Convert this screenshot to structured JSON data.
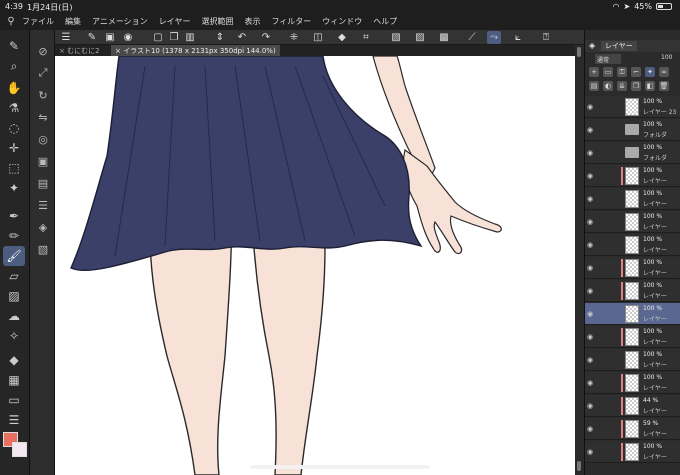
{
  "status": {
    "time": "4:39",
    "date": "1月24日(日)",
    "battery": "45%",
    "battery_level": 0.45
  },
  "menu": [
    "ファイル",
    "編集",
    "アニメーション",
    "レイヤー",
    "選択範囲",
    "表示",
    "フィルター",
    "ウィンドウ",
    "ヘルプ"
  ],
  "tabs": {
    "tab1": "むにむに2",
    "tab2": "イラスト10 (1378 x 2131px 350dpi 144.0%)"
  },
  "layer_panel": {
    "title": "レイヤー",
    "blend_mode": "通常",
    "opacity": "100",
    "layers": [
      {
        "pct": "100 %",
        "name": "レイヤー 23",
        "kind": "layer",
        "mask": false
      },
      {
        "pct": "100 %",
        "name": "フォルダ",
        "kind": "folder",
        "mask": false
      },
      {
        "pct": "100 %",
        "name": "フォルダ",
        "kind": "folder",
        "mask": false
      },
      {
        "pct": "100 %",
        "name": "レイヤー",
        "kind": "layer",
        "mask": true
      },
      {
        "pct": "100 %",
        "name": "レイヤー",
        "kind": "layer",
        "mask": false
      },
      {
        "pct": "100 %",
        "name": "レイヤー",
        "kind": "layer",
        "mask": false
      },
      {
        "pct": "100 %",
        "name": "レイヤー",
        "kind": "layer",
        "mask": false
      },
      {
        "pct": "100 %",
        "name": "レイヤー",
        "kind": "layer",
        "mask": true
      },
      {
        "pct": "100 %",
        "name": "レイヤー",
        "kind": "layer",
        "mask": true
      },
      {
        "pct": "100 %",
        "name": "レイヤー",
        "kind": "layer",
        "mask": false
      },
      {
        "pct": "100 %",
        "name": "レイヤー",
        "kind": "layer",
        "mask": true
      },
      {
        "pct": "100 %",
        "name": "レイヤー",
        "kind": "layer",
        "mask": false
      },
      {
        "pct": "100 %",
        "name": "レイヤー",
        "kind": "layer",
        "mask": true
      },
      {
        "pct": "44 %",
        "name": "レイヤー",
        "kind": "layer",
        "mask": true
      },
      {
        "pct": "59 %",
        "name": "レイヤー",
        "kind": "layer",
        "mask": true
      },
      {
        "pct": "100 %",
        "name": "レイヤー",
        "kind": "layer",
        "mask": true
      }
    ]
  },
  "colors": {
    "main": "#e87060",
    "sub": "#f2e8f0",
    "skirt": "#3a4068",
    "accent": "#4d5d80"
  },
  "icons": {
    "tools": [
      "pen-icon",
      "zoom-icon",
      "hand-icon",
      "eyedropper-icon",
      "lasso-icon",
      "move-icon",
      "select-icon",
      "magic-wand-icon",
      "pen-nib-icon",
      "pencil-icon",
      "brush-icon",
      "eraser-icon",
      "fill-icon",
      "airbrush-icon",
      "blend-icon",
      "bucket-icon",
      "gradient-icon",
      "figure-icon",
      "text-icon"
    ]
  }
}
